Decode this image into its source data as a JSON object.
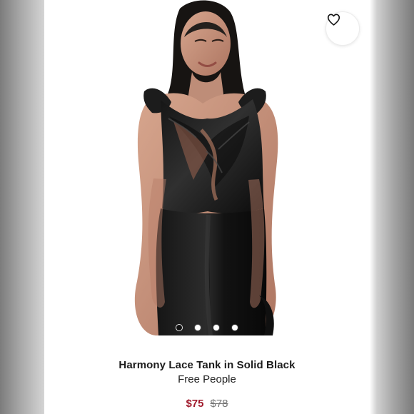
{
  "product": {
    "title": "Harmony Lace Tank in Solid Black",
    "brand": "Free People",
    "sale_price": "$75",
    "original_price": "$78"
  },
  "image_carousel": {
    "dot_count": 4,
    "active_dot": 1
  },
  "colors": {
    "sale_price": "#a11d2e",
    "muted_price": "#737373",
    "active_dot": "#111111",
    "inactive_dot": "#ffffff"
  },
  "icons": {
    "wishlist": "heart-icon"
  }
}
